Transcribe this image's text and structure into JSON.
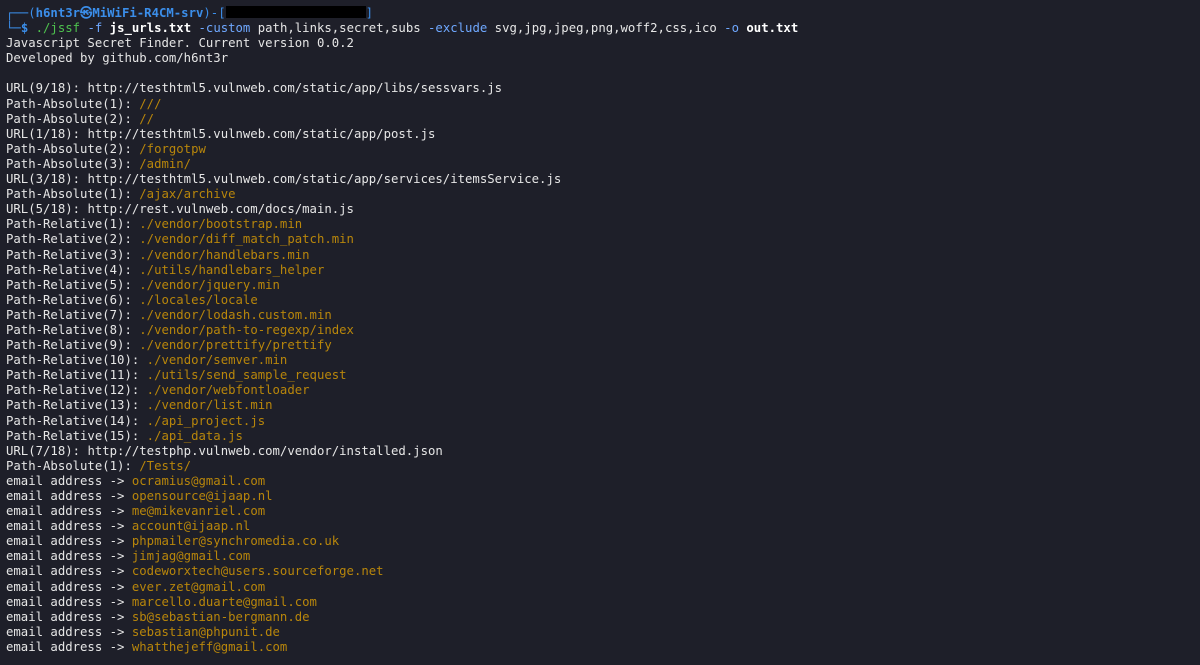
{
  "prompt": {
    "corner_top": "┌──(",
    "user_host": "h6nt3r㉿MiWiFi-R4CM-srv",
    "mid": ")-[",
    "end": "]",
    "corner_bottom": "└─",
    "dollar": "$ "
  },
  "command": {
    "name": "./jssf",
    "flag_f": " -f ",
    "arg_input": "js_urls.txt",
    "flag_custom": " -custom ",
    "arg_custom": "path,links,secret,subs",
    "flag_exclude": " -exclude ",
    "arg_exclude": "svg,jpg,jpeg,png,woff2,css,ico",
    "flag_o": " -o ",
    "arg_out": "out.txt"
  },
  "banner": [
    "Javascript Secret Finder. Current version 0.0.2",
    "Developed by github.com/h6nt3r",
    ""
  ],
  "output_lines": [
    {
      "label": "URL(9/18): ",
      "value": "http://testhtml5.vulnweb.com/static/app/libs/sessvars.js",
      "kind": "url"
    },
    {
      "label": "Path-Absolute(1): ",
      "value": "///",
      "kind": "path"
    },
    {
      "label": "Path-Absolute(2): ",
      "value": "//",
      "kind": "path"
    },
    {
      "label": "URL(1/18): ",
      "value": "http://testhtml5.vulnweb.com/static/app/post.js",
      "kind": "url"
    },
    {
      "label": "Path-Absolute(2): ",
      "value": "/forgotpw",
      "kind": "path"
    },
    {
      "label": "Path-Absolute(3): ",
      "value": "/admin/",
      "kind": "path"
    },
    {
      "label": "URL(3/18): ",
      "value": "http://testhtml5.vulnweb.com/static/app/services/itemsService.js",
      "kind": "url"
    },
    {
      "label": "Path-Absolute(1): ",
      "value": "/ajax/archive",
      "kind": "path"
    },
    {
      "label": "URL(5/18): ",
      "value": "http://rest.vulnweb.com/docs/main.js",
      "kind": "url"
    },
    {
      "label": "Path-Relative(1): ",
      "value": "./vendor/bootstrap.min",
      "kind": "path"
    },
    {
      "label": "Path-Relative(2): ",
      "value": "./vendor/diff_match_patch.min",
      "kind": "path"
    },
    {
      "label": "Path-Relative(3): ",
      "value": "./vendor/handlebars.min",
      "kind": "path"
    },
    {
      "label": "Path-Relative(4): ",
      "value": "./utils/handlebars_helper",
      "kind": "path"
    },
    {
      "label": "Path-Relative(5): ",
      "value": "./vendor/jquery.min",
      "kind": "path"
    },
    {
      "label": "Path-Relative(6): ",
      "value": "./locales/locale",
      "kind": "path"
    },
    {
      "label": "Path-Relative(7): ",
      "value": "./vendor/lodash.custom.min",
      "kind": "path"
    },
    {
      "label": "Path-Relative(8): ",
      "value": "./vendor/path-to-regexp/index",
      "kind": "path"
    },
    {
      "label": "Path-Relative(9): ",
      "value": "./vendor/prettify/prettify",
      "kind": "path"
    },
    {
      "label": "Path-Relative(10): ",
      "value": "./vendor/semver.min",
      "kind": "path"
    },
    {
      "label": "Path-Relative(11): ",
      "value": "./utils/send_sample_request",
      "kind": "path"
    },
    {
      "label": "Path-Relative(12): ",
      "value": "./vendor/webfontloader",
      "kind": "path"
    },
    {
      "label": "Path-Relative(13): ",
      "value": "./vendor/list.min",
      "kind": "path"
    },
    {
      "label": "Path-Relative(14): ",
      "value": "./api_project.js",
      "kind": "path"
    },
    {
      "label": "Path-Relative(15): ",
      "value": "./api_data.js",
      "kind": "path"
    },
    {
      "label": "URL(7/18): ",
      "value": "http://testphp.vulnweb.com/vendor/installed.json",
      "kind": "url"
    },
    {
      "label": "Path-Absolute(1): ",
      "value": "/Tests/",
      "kind": "path"
    },
    {
      "label": "email address -> ",
      "value": "ocramius@gmail.com",
      "kind": "email"
    },
    {
      "label": "email address -> ",
      "value": "opensource@ijaap.nl",
      "kind": "email"
    },
    {
      "label": "email address -> ",
      "value": "me@mikevanriel.com",
      "kind": "email"
    },
    {
      "label": "email address -> ",
      "value": "account@ijaap.nl",
      "kind": "email"
    },
    {
      "label": "email address -> ",
      "value": "phpmailer@synchromedia.co.uk",
      "kind": "email"
    },
    {
      "label": "email address -> ",
      "value": "jimjag@gmail.com",
      "kind": "email"
    },
    {
      "label": "email address -> ",
      "value": "codeworxtech@users.sourceforge.net",
      "kind": "email"
    },
    {
      "label": "email address -> ",
      "value": "ever.zet@gmail.com",
      "kind": "email"
    },
    {
      "label": "email address -> ",
      "value": "marcello.duarte@gmail.com",
      "kind": "email"
    },
    {
      "label": "email address -> ",
      "value": "sb@sebastian-bergmann.de",
      "kind": "email"
    },
    {
      "label": "email address -> ",
      "value": "sebastian@phpunit.de",
      "kind": "email"
    },
    {
      "label": "email address -> ",
      "value": "whatthejeff@gmail.com",
      "kind": "email"
    }
  ],
  "colors": {
    "background": "#1e1f29",
    "text": "#e6e6e6",
    "prompt_blue": "#3b8eea",
    "command_green": "#4ec24e",
    "found_value": "#b8860b"
  }
}
